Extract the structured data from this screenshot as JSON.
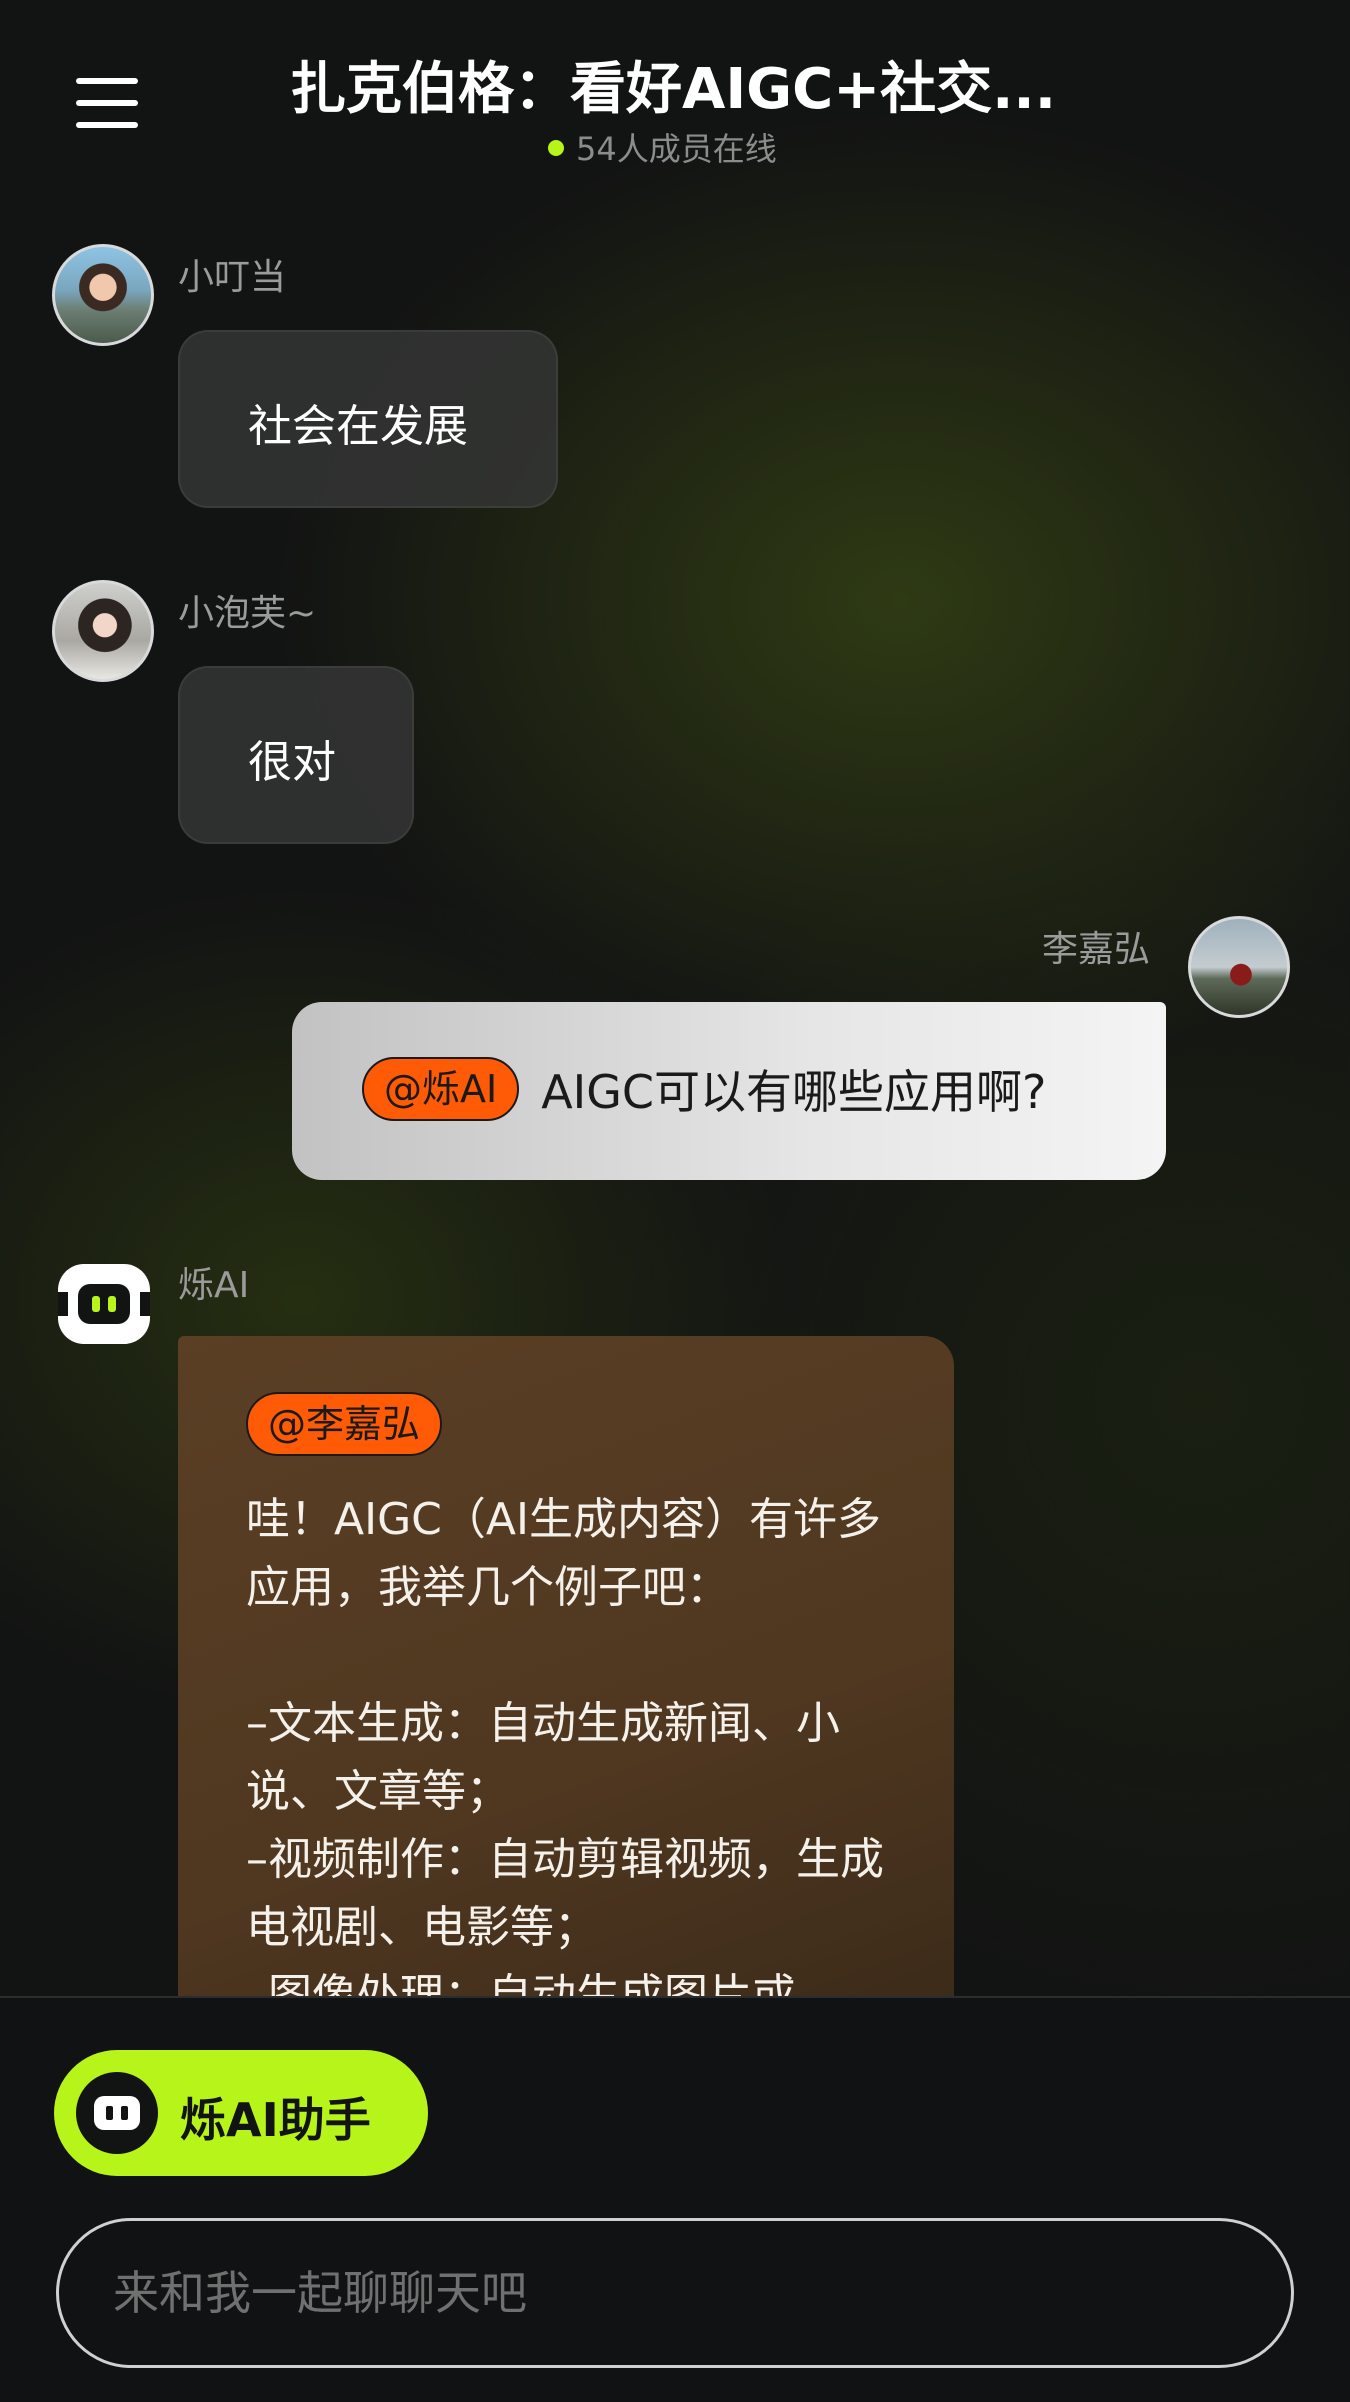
{
  "header": {
    "title": "扎克伯格：看好AIGC+社交...",
    "online_text": "54人成员在线"
  },
  "messages": [
    {
      "user": "小叮当",
      "text": "社会在发展"
    },
    {
      "user": "小泡芙~",
      "text": "很对"
    },
    {
      "user": "李嘉弘",
      "mention": "@烁AI",
      "text": "AIGC可以有哪些应用啊?"
    },
    {
      "user": "烁AI",
      "mention": "@李嘉弘",
      "text": "哇！AIGC（AI生成内容）有许多应用，我举几个例子吧：\n\n–文本生成：自动生成新闻、小说、文章等；\n–视频制作：自动剪辑视频，生成电视剧、电影等；\n–图像处理：自动生成图片或"
    }
  ],
  "assistant_button": {
    "label": "烁AI助手"
  },
  "input": {
    "placeholder": "来和我一起聊聊天吧"
  },
  "colors": {
    "accent": "#b6f41a",
    "mention": "#ff5a06",
    "background": "#121313"
  }
}
